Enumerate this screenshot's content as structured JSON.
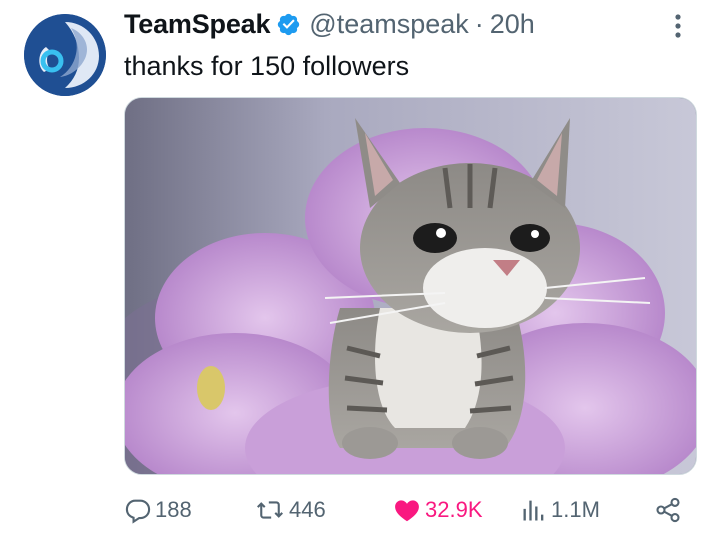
{
  "author": {
    "name": "TeamSpeak",
    "handle": "@teamspeak",
    "separator": "·",
    "time": "20h",
    "verified": true
  },
  "tweet": {
    "text": "thanks for 150 followers",
    "media": {
      "kind": "photo",
      "icon": "cat-photo"
    }
  },
  "actions": {
    "reply_count": "188",
    "retweet_count": "446",
    "like_count": "32.9K",
    "view_count": "1.1M"
  },
  "colors": {
    "like": "#f91880",
    "muted": "#536471",
    "verified": "#1d9bf0",
    "avatar_bg": "#1f4f93"
  }
}
